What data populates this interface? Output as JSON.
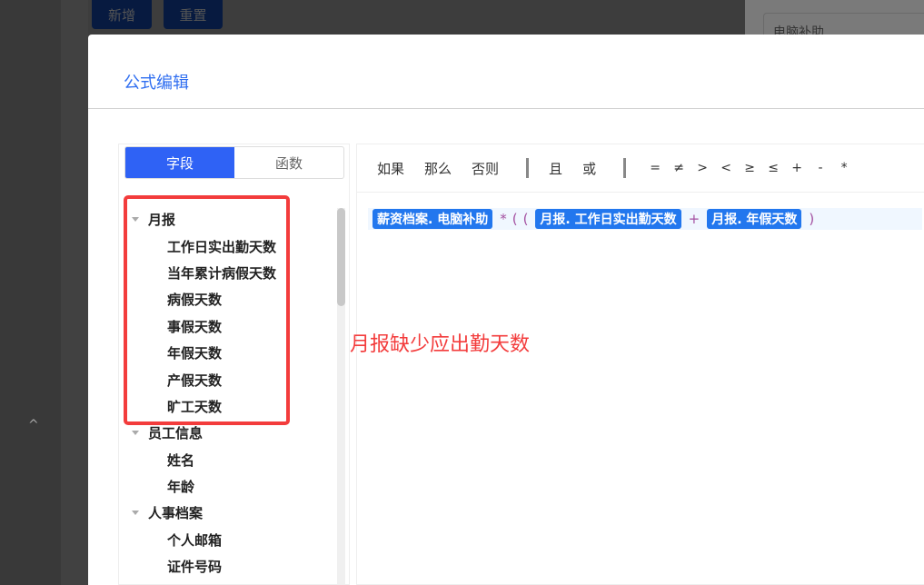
{
  "background": {
    "buttons": [
      "新增",
      "重置"
    ],
    "input_value": "电脑补助"
  },
  "modal": {
    "title": "公式编辑"
  },
  "tabs": [
    "字段",
    "函数"
  ],
  "tree": [
    {
      "label": "月报",
      "children": [
        "工作日实出勤天数",
        "当年累计病假天数",
        "病假天数",
        "事假天数",
        "年假天数",
        "产假天数",
        "旷工天数"
      ]
    },
    {
      "label": "员工信息",
      "children": [
        "姓名",
        "年龄"
      ]
    },
    {
      "label": "人事档案",
      "children": [
        "个人邮箱",
        "证件号码"
      ]
    }
  ],
  "annotation": "月报缺少应出勤天数",
  "toolbar": {
    "logic": [
      "如果",
      "那么",
      "否则"
    ],
    "conj": [
      "且",
      "或"
    ],
    "ops": [
      "=",
      "≠",
      ">",
      "<",
      "≥",
      "≤",
      "+",
      "-",
      "*"
    ]
  },
  "formula": {
    "t1": "薪资档案. 电脑补助",
    "s1": "*",
    "s2": "(",
    "s3": "(",
    "t2": "月报. 工作日实出勤天数",
    "s4": "+",
    "t3": "月报. 年假天数",
    "s5": ")"
  }
}
